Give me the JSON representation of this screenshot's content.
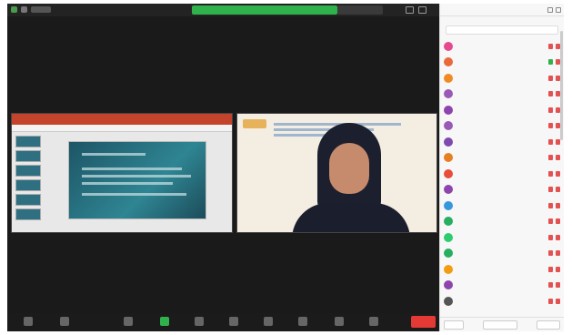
{
  "window": {
    "icons": [
      "shield-icon",
      "grid-icon"
    ]
  },
  "meeting": {
    "share_banner_color": "#2fb24c",
    "toolbar_items": [
      {
        "icon": "microphone-icon"
      },
      {
        "icon": "video-icon"
      },
      {
        "icon": "security-icon"
      },
      {
        "icon": "participants-icon"
      },
      {
        "icon": "share-screen-icon"
      },
      {
        "icon": "chat-icon"
      },
      {
        "icon": "record-icon"
      },
      {
        "icon": "reactions-icon"
      },
      {
        "icon": "apps-icon"
      },
      {
        "icon": "more-icon"
      }
    ],
    "end_color": "#e53935"
  },
  "participants_panel": {
    "participants": [
      {
        "color": "#e64a8c"
      },
      {
        "color": "#e86a3a",
        "host": true
      },
      {
        "color": "#f08a24"
      },
      {
        "color": "#9b59b6"
      },
      {
        "color": "#8e44ad"
      },
      {
        "color": "#9b59b6"
      },
      {
        "color": "#7f4ab0"
      },
      {
        "color": "#e67e22"
      },
      {
        "color": "#e74c3c"
      },
      {
        "color": "#8e44ad"
      },
      {
        "color": "#3498db"
      },
      {
        "color": "#27ae60"
      },
      {
        "color": "#2ecc71"
      },
      {
        "color": "#27ae60"
      },
      {
        "color": "#f39c12"
      },
      {
        "color": "#8e44ad"
      },
      {
        "color": "#555555"
      }
    ]
  }
}
